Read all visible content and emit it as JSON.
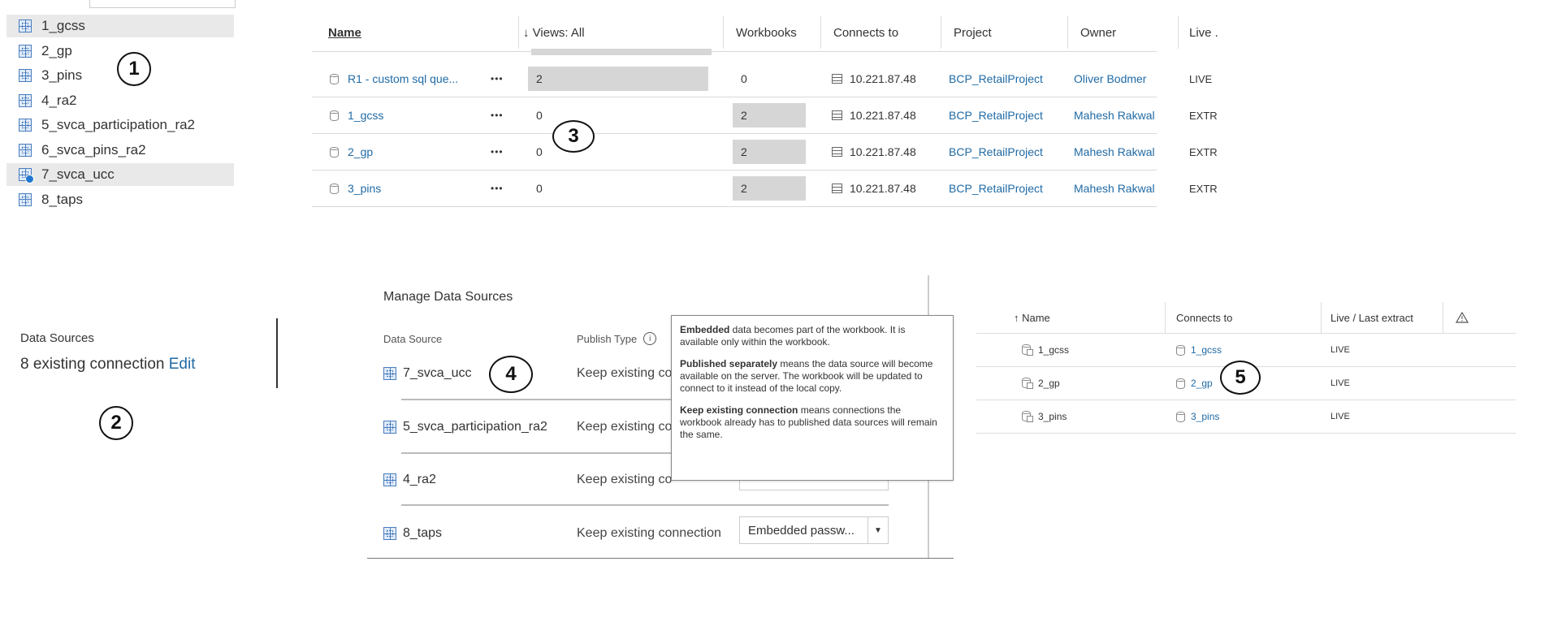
{
  "colors": {
    "link": "#1f6aa5",
    "icon_blue": "#4a7dbf",
    "selection": "#e9e9e9",
    "bar": "#d6d6d6"
  },
  "callouts": [
    "1",
    "2",
    "3",
    "4",
    "5"
  ],
  "panel1": {
    "items": [
      {
        "label": "1_gcss",
        "selected": true
      },
      {
        "label": "2_gp"
      },
      {
        "label": "3_pins"
      },
      {
        "label": "4_ra2"
      },
      {
        "label": "5_svca_participation_ra2"
      },
      {
        "label": "6_svca_pins_ra2"
      },
      {
        "label": "7_svca_ucc",
        "selected": true,
        "badge": true
      },
      {
        "label": "8_taps"
      }
    ]
  },
  "panel2": {
    "title": "Data Sources",
    "text": "8 existing connection",
    "edit": "Edit"
  },
  "panel3": {
    "columns": [
      "Name",
      "↓ Views: All",
      "Workbooks",
      "Connects to",
      "Project",
      "Owner",
      "Live ."
    ],
    "rows": [
      {
        "name": "R1 - custom sql que...",
        "more": "•••",
        "views": "2",
        "workbooks": "0",
        "connects": "10.221.87.48",
        "project": "BCP_RetailProject",
        "owner": "Oliver Bodmer",
        "live": "LIVE"
      },
      {
        "name": "1_gcss",
        "more": "•••",
        "views": "0",
        "workbooks": "2",
        "connects": "10.221.87.48",
        "project": "BCP_RetailProject",
        "owner": "Mahesh Rakwal",
        "live": "EXTR"
      },
      {
        "name": "2_gp",
        "more": "•••",
        "views": "0",
        "workbooks": "2",
        "connects": "10.221.87.48",
        "project": "BCP_RetailProject",
        "owner": "Mahesh Rakwal",
        "live": "EXTR"
      },
      {
        "name": "3_pins",
        "more": "•••",
        "views": "0",
        "workbooks": "2",
        "connects": "10.221.87.48",
        "project": "BCP_RetailProject",
        "owner": "Mahesh Rakwal",
        "live": "EXTR"
      }
    ]
  },
  "panel4": {
    "title": "Manage Data Sources",
    "col_source": "Data Source",
    "col_publish": "Publish Type",
    "rows": [
      {
        "source": "7_svca_ucc",
        "publish": "Keep existing co"
      },
      {
        "source": "5_svca_participation_ra2",
        "publish": "Keep existing co"
      },
      {
        "source": "4_ra2",
        "publish": "Keep existing co"
      },
      {
        "source": "8_taps",
        "publish": "Keep existing connection"
      }
    ],
    "select_value": "Embedded passw...",
    "tooltip": {
      "p1_bold": "Embedded",
      "p1_rest": " data becomes part of the workbook. It is available only within the workbook.",
      "p2_bold": "Published separately",
      "p2_rest": " means the data source will become available on the server. The workbook will be updated to connect to it instead of the local copy.",
      "p3_bold": "Keep existing connection",
      "p3_rest": " means connections the workbook already has to published data sources will remain the same."
    }
  },
  "panel5": {
    "columns": [
      "↑ Name",
      "Connects to",
      "Live / Last extract"
    ],
    "warning_icon": "warning-icon",
    "rows": [
      {
        "name": "1_gcss",
        "connects": "1_gcss",
        "live": "LIVE"
      },
      {
        "name": "2_gp",
        "connects": "2_gp",
        "live": "LIVE"
      },
      {
        "name": "3_pins",
        "connects": "3_pins",
        "live": "LIVE"
      }
    ]
  }
}
